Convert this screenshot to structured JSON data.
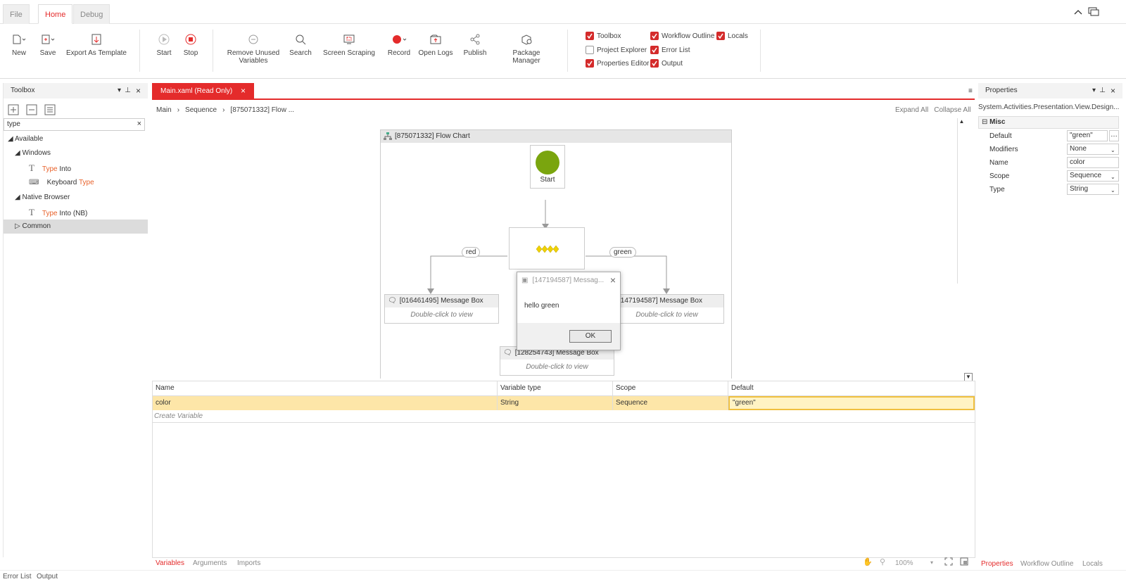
{
  "tabs": {
    "file": "File",
    "home": "Home",
    "debug": "Debug"
  },
  "ribbon": {
    "new": "New",
    "save": "Save",
    "export_template": "Export As Template",
    "start": "Start",
    "stop": "Stop",
    "remove_unused_1": "Remove Unused",
    "remove_unused_2": "Variables",
    "search": "Search",
    "screen_scraping": "Screen Scraping",
    "record": "Record",
    "open_logs": "Open Logs",
    "publish": "Publish",
    "package_manager": "Package Manager",
    "panels": {
      "toolbox": "Toolbox",
      "workflow_outline": "Workflow Outline",
      "locals": "Locals",
      "project_explorer": "Project Explorer",
      "error_list": "Error List",
      "properties_editor": "Properties Editor",
      "output": "Output"
    }
  },
  "toolbox": {
    "title": "Toolbox",
    "search_value": "type",
    "available": "Available",
    "windows": "Windows",
    "type_into_a": "Type",
    "type_into_b": " Into",
    "keyboard_a": "Keyboard ",
    "keyboard_b": "Type",
    "native_browser": "Native Browser",
    "nb_a": "Type",
    "nb_b": " Into (NB)",
    "common": "Common"
  },
  "document": {
    "tab": "Main.xaml (Read Only)",
    "breadcrumb": [
      "Main",
      "Sequence",
      "[875071332] Flow ..."
    ],
    "expand_all": "Expand All",
    "collapse_all": "Collapse All"
  },
  "flow": {
    "title": "[875071332] Flow Chart",
    "start": "Start",
    "edge_left": "red",
    "edge_right": "green",
    "box_left": "[016461495] Message Box",
    "box_right": "[147194587] Message Box",
    "box_bottom": "[128254743] Message Box",
    "hint": "Double-click to view"
  },
  "dialog": {
    "title": "[147194587] Messag...",
    "message": "hello green",
    "ok": "OK"
  },
  "variables": {
    "headers": [
      "Name",
      "Variable type",
      "Scope",
      "Default"
    ],
    "row": [
      "color",
      "String",
      "Sequence",
      "\"green\""
    ],
    "create": "Create Variable"
  },
  "bottom_tabs": {
    "variables": "Variables",
    "arguments": "Arguments",
    "imports": "Imports",
    "zoom": "100%"
  },
  "properties": {
    "title": "Properties",
    "type_name": "System.Activities.Presentation.View.Design...",
    "section": "Misc",
    "rows": [
      {
        "label": "Default",
        "value": "\"green\""
      },
      {
        "label": "Modifiers",
        "value": "None"
      },
      {
        "label": "Name",
        "value": "color"
      },
      {
        "label": "Scope",
        "value": "Sequence"
      },
      {
        "label": "Type",
        "value": "String"
      }
    ],
    "tabs": {
      "properties": "Properties",
      "workflow_outline": "Workflow Outline",
      "locals": "Locals"
    }
  },
  "status": {
    "error_list": "Error List",
    "output": "Output"
  },
  "colors": {
    "accent": "#e42b2b",
    "row_highlight": "#fde6a8",
    "start_green": "#7aa50e"
  }
}
